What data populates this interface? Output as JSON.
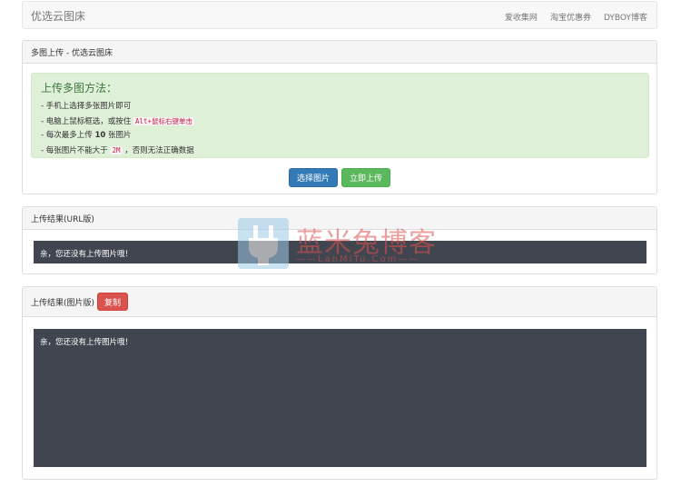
{
  "navbar": {
    "brand": "优选云图床",
    "links": [
      "爱收集网",
      "淘宝优惠券",
      "DYBOY博客"
    ]
  },
  "upload_panel": {
    "heading": "多图上传 - 优选云图床",
    "alert": {
      "title": "上传多图方法：",
      "line1": "- 手机上选择多张图片即可",
      "line2_prefix": "- 电脑上鼠标框选，或按住 ",
      "line2_code": "Alt+鼠标右键单击",
      "line3_prefix": "- 每次最多上传 ",
      "line3_bold": "10",
      "line3_suffix": " 张图片",
      "line4_prefix": "- 每张图片不能大于 ",
      "line4_code": "2M",
      "line4_suffix": " ，否则无法正确数据"
    },
    "select_button": "选择图片",
    "upload_button": "立即上传"
  },
  "url_panel": {
    "heading": "上传结果(URL版)",
    "content": "亲，您还没有上传图片哦！"
  },
  "image_panel": {
    "heading": "上传结果(图片版)",
    "copy_button": "复制",
    "content": "亲，您还没有上传图片哦！"
  },
  "watermark": {
    "title": "蓝米兔博客",
    "subtitle": "——LanMiTu.Com——"
  },
  "colors": {
    "primary": "#337ab7",
    "success": "#5cb85c",
    "danger": "#d9534f",
    "alert_bg": "#dff0d8",
    "code_bg": "#41454f"
  }
}
